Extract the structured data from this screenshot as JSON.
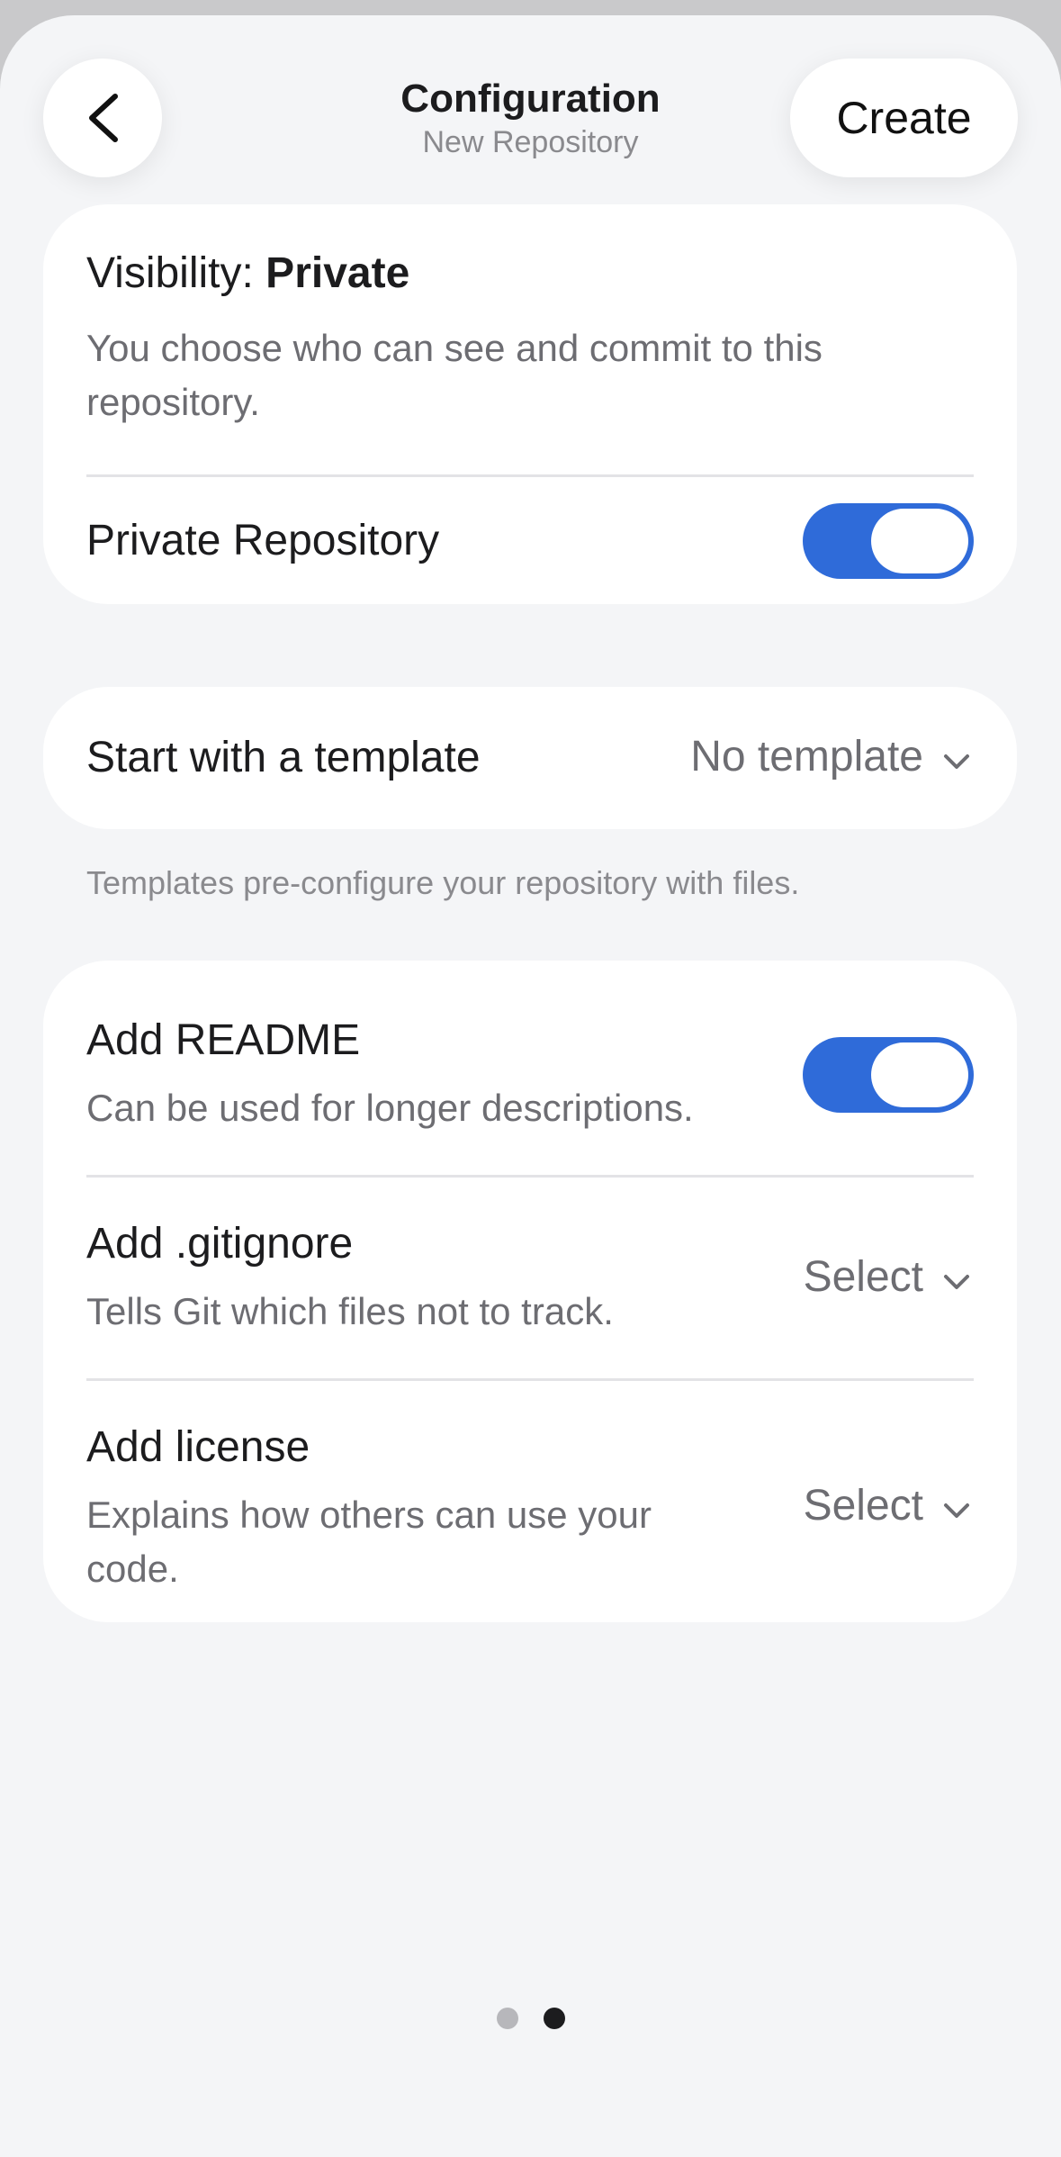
{
  "header": {
    "title": "Configuration",
    "subtitle": "New Repository",
    "back_icon": "chevron-left-icon",
    "create_label": "Create"
  },
  "visibility": {
    "label_prefix": "Visibility: ",
    "label_value": "Private",
    "description": "You choose who can see and commit to this repository.",
    "private_repo_label": "Private Repository",
    "private_repo_enabled": true
  },
  "template": {
    "label": "Start with a template",
    "selected": "No template",
    "footnote": "Templates pre-configure your repository with files."
  },
  "options": {
    "readme": {
      "title": "Add README",
      "description": "Can be used for longer descriptions.",
      "enabled": true
    },
    "gitignore": {
      "title": "Add .gitignore",
      "description": "Tells Git which files not to track.",
      "selected": "Select"
    },
    "license": {
      "title": "Add license",
      "description": "Explains how others can use your code.",
      "selected": "Select"
    }
  },
  "pager": {
    "total": 2,
    "current": 2
  },
  "colors": {
    "accent": "#2f6bd9",
    "background": "#f4f5f7",
    "card": "#ffffff"
  }
}
